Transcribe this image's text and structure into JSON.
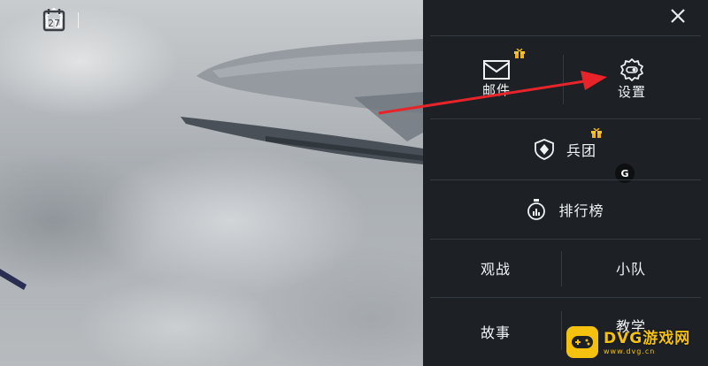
{
  "topbar": {
    "calendar_day": "27"
  },
  "menu": {
    "mail_label": "邮件",
    "settings_label": "设置",
    "legion_label": "兵团",
    "leaderboard_label": "排行榜",
    "spectate_label": "观战",
    "squad_label": "小队",
    "story_label": "故事",
    "tutorial_label": "教学"
  },
  "badge": {
    "g_label": "G"
  },
  "watermark": {
    "title": "DVG游戏网",
    "domain": "www.dvg.cn"
  },
  "colors": {
    "panel_bg": "#1d2126",
    "divider": "#343a41",
    "gift": "#f0b21c",
    "arrow": "#e8242a",
    "watermark": "#f4c10e"
  },
  "icons": [
    "home-icon",
    "calendar-icon",
    "close-icon",
    "mail-icon",
    "settings-gear-icon",
    "legion-shield-icon",
    "leaderboard-stopwatch-icon",
    "gift-icon"
  ]
}
